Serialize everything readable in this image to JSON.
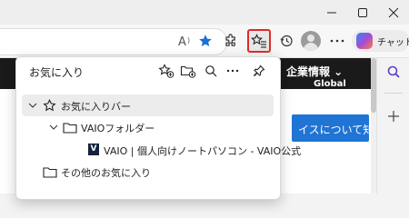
{
  "toolbar": {
    "read_aloud_icon": "read-aloud-icon",
    "favorite_star_icon": "add-favorite-star-icon",
    "extensions_icon": "extensions-icon",
    "favorites_icon": "favorites-icon",
    "history_icon": "history-icon",
    "more_icon": "more-icon",
    "copilot_label": "チャット"
  },
  "window": {
    "minimize_icon": "minimize-icon",
    "maximize_icon": "maximize-icon",
    "close_icon": "close-icon"
  },
  "page": {
    "nav_title": "企業情報 ⌄",
    "nav_sub": "Global",
    "cta_label": "イスについて知る"
  },
  "favorites_panel": {
    "title": "お気に入り",
    "actions": [
      "add-favorite-icon",
      "add-folder-icon",
      "search-icon",
      "more-icon",
      "pin-icon"
    ],
    "items": [
      {
        "label": "お気に入りバー",
        "type": "folder-bar",
        "expanded": true,
        "selected": true
      },
      {
        "label": "VAIOフォルダー",
        "type": "folder",
        "expanded": true
      },
      {
        "label": "VAIO | 個人向けノートパソコン - VAIO公式",
        "type": "link",
        "favicon": "V"
      },
      {
        "label": "その他のお気に入り",
        "type": "folder"
      }
    ]
  },
  "colors": {
    "accent": "#1f74d4",
    "highlight_border": "#e02b2b",
    "page_nav": "#1a1a1a"
  }
}
